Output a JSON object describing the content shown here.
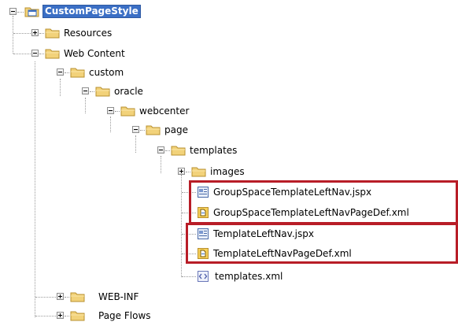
{
  "tree": {
    "root": {
      "label": "CustomPageStyle",
      "icon": "project-folder-icon",
      "state": "expanded",
      "selected": true
    },
    "resources": {
      "label": "Resources",
      "icon": "folder-icon",
      "state": "collapsed"
    },
    "web_content": {
      "label": "Web Content",
      "icon": "folder-icon",
      "state": "expanded"
    },
    "custom": {
      "label": "custom",
      "icon": "folder-icon",
      "state": "expanded"
    },
    "oracle": {
      "label": "oracle",
      "icon": "folder-icon",
      "state": "expanded"
    },
    "webcenter": {
      "label": "webcenter",
      "icon": "folder-icon",
      "state": "expanded"
    },
    "page": {
      "label": "page",
      "icon": "folder-icon",
      "state": "expanded"
    },
    "templates": {
      "label": "templates",
      "icon": "folder-icon",
      "state": "expanded"
    },
    "images": {
      "label": "images",
      "icon": "folder-icon",
      "state": "collapsed"
    },
    "group_nav_jspx": {
      "label": "GroupSpaceTemplateLeftNav.jspx",
      "icon": "jspx-file-icon",
      "highlighted": true
    },
    "group_nav_pagedef": {
      "label": "GroupSpaceTemplateLeftNavPageDef.xml",
      "icon": "pagedef-file-icon",
      "highlighted": true
    },
    "nav_jspx": {
      "label": "TemplateLeftNav.jspx",
      "icon": "jspx-file-icon",
      "highlighted": true
    },
    "nav_pagedef": {
      "label": "TemplateLeftNavPageDef.xml",
      "icon": "pagedef-file-icon",
      "highlighted": true
    },
    "templates_xml": {
      "label": "templates.xml",
      "icon": "xml-file-icon"
    },
    "web_inf": {
      "label": "WEB-INF",
      "icon": "folder-icon",
      "state": "collapsed"
    },
    "page_flows": {
      "label": "Page Flows",
      "icon": "folder-icon",
      "state": "collapsed"
    }
  },
  "colors": {
    "highlight_border": "#b81d27",
    "selection_bg": "#3b6fc5",
    "folder_fill": "#f2d27a",
    "folder_stroke": "#b8902f"
  }
}
